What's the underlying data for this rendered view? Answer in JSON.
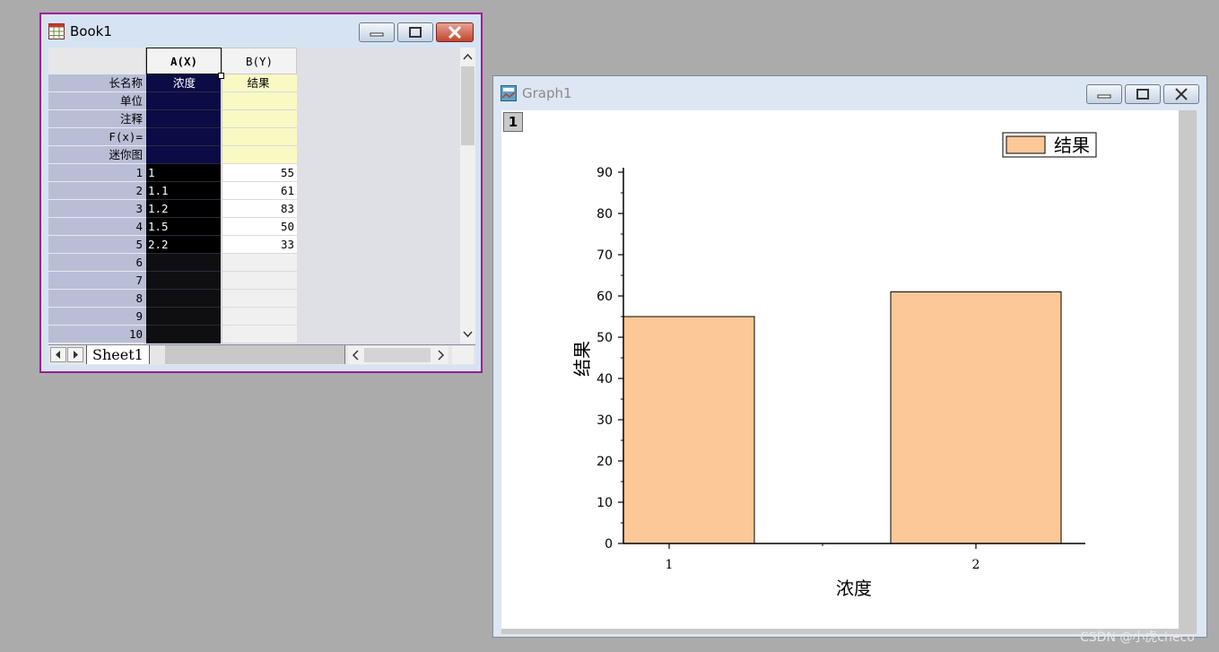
{
  "book": {
    "title": "Book1",
    "columns": [
      {
        "name": "A(X)"
      },
      {
        "name": "B(Y)"
      }
    ],
    "meta_rows": [
      "长名称",
      "单位",
      "注释",
      "F(x)=",
      "迷你图"
    ],
    "long_names": [
      "浓度",
      "结果"
    ],
    "row_numbers": [
      "1",
      "2",
      "3",
      "4",
      "5",
      "6",
      "7",
      "8",
      "9",
      "10"
    ],
    "col_a": [
      "1",
      "1.1",
      "1.2",
      "1.5",
      "2.2"
    ],
    "col_b": [
      "55",
      "61",
      "83",
      "50",
      "33"
    ],
    "sheet_tab": "Sheet1"
  },
  "graph": {
    "title": "Graph1",
    "layer_label": "1"
  },
  "chart_data": {
    "type": "bar",
    "categories": [
      "1",
      "2"
    ],
    "series": [
      {
        "name": "结果",
        "values": [
          55,
          61
        ]
      }
    ],
    "xlabel": "浓度",
    "ylabel": "结果",
    "ylim": [
      0,
      90
    ],
    "yticks": [
      0,
      10,
      20,
      30,
      40,
      50,
      60,
      70,
      80,
      90
    ],
    "bar_color": "#fcc897",
    "legend_position": "top-right",
    "grid": false
  },
  "watermark": "CSDN @小虎checo"
}
